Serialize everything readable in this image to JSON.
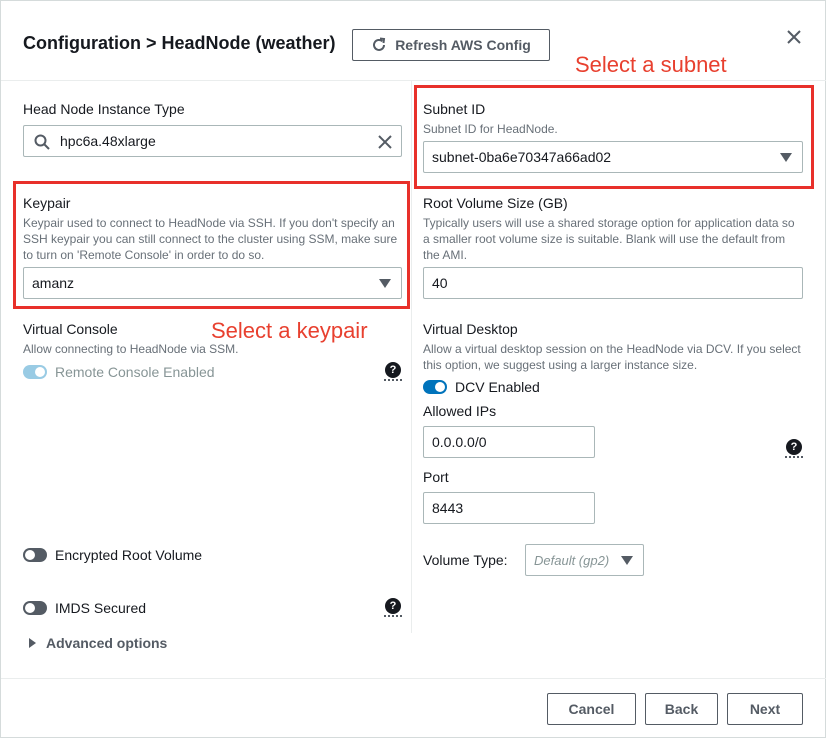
{
  "header": {
    "title": "Configuration > HeadNode (weather)",
    "refresh_label": "Refresh AWS Config"
  },
  "annotations": {
    "subnet": "Select a subnet",
    "keypair": "Select a keypair"
  },
  "instance_type": {
    "label": "Head Node Instance Type",
    "value": "hpc6a.48xlarge"
  },
  "subnet": {
    "label": "Subnet ID",
    "desc": "Subnet ID for HeadNode.",
    "value": "subnet-0ba6e70347a66ad02"
  },
  "keypair": {
    "label": "Keypair",
    "desc": "Keypair used to connect to HeadNode via SSH. If you don't specify an SSH keypair you can still connect to the cluster using SSM, make sure to turn on 'Remote Console' in order to do so.",
    "value": "amanz"
  },
  "root_volume": {
    "label": "Root Volume Size (GB)",
    "desc": "Typically users will use a shared storage option for application data so a smaller root volume size is suitable. Blank will use the default from the AMI.",
    "value": "40"
  },
  "virtual_console": {
    "label": "Virtual Console",
    "desc": "Allow connecting to HeadNode via SSM.",
    "toggle_label": "Remote Console Enabled",
    "enabled": true,
    "disabled": true
  },
  "virtual_desktop": {
    "label": "Virtual Desktop",
    "desc": "Allow a virtual desktop session on the HeadNode via DCV. If you select this option, we suggest using a larger instance size.",
    "toggle_label": "DCV Enabled",
    "enabled": true,
    "allowed_ips_label": "Allowed IPs",
    "allowed_ips_value": "0.0.0.0/0",
    "port_label": "Port",
    "port_value": "8443"
  },
  "encrypted_root": {
    "label": "Encrypted Root Volume",
    "enabled": false
  },
  "imds": {
    "label": "IMDS Secured",
    "enabled": false
  },
  "volume_type": {
    "label": "Volume Type:",
    "placeholder": "Default (gp2)"
  },
  "advanced": {
    "label": "Advanced options"
  },
  "footer": {
    "cancel": "Cancel",
    "back": "Back",
    "next": "Next"
  },
  "colors": {
    "accent": "#0073bb",
    "annotation": "#e8302a",
    "toggle_off": "#545b64",
    "toggle_disabled": "#99cbe4"
  },
  "icons": {
    "refresh": "refresh-icon",
    "close": "close-icon",
    "search": "search-icon",
    "clear": "clear-icon",
    "help": "help-icon"
  }
}
